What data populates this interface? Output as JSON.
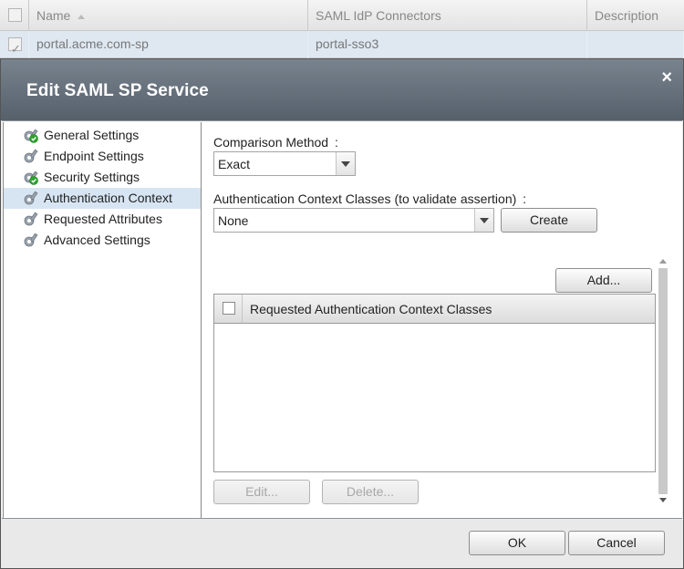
{
  "background_grid": {
    "columns": [
      "Name",
      "SAML IdP Connectors",
      "Description"
    ],
    "row": {
      "name": "portal.acme.com-sp",
      "connectors": "portal-sso3",
      "description": ""
    }
  },
  "dialog": {
    "title": "Edit SAML SP Service",
    "close_icon": "×",
    "nav": {
      "items": [
        {
          "label": "General Settings",
          "icon": "gear-check-icon",
          "selected": false
        },
        {
          "label": "Endpoint Settings",
          "icon": "gear-icon",
          "selected": false
        },
        {
          "label": "Security Settings",
          "icon": "gear-check-icon",
          "selected": false
        },
        {
          "label": "Authentication Context",
          "icon": "gear-icon",
          "selected": true
        },
        {
          "label": "Requested Attributes",
          "icon": "gear-icon",
          "selected": false
        },
        {
          "label": "Advanced Settings",
          "icon": "gear-icon",
          "selected": false
        }
      ]
    },
    "content": {
      "comparison_label": "Comparison Method",
      "comparison_colon": ":",
      "comparison_value": "Exact",
      "classes_label": "Authentication Context Classes (to validate assertion)",
      "classes_colon": ":",
      "classes_value": "None",
      "create_button": "Create",
      "add_button": "Add...",
      "table_header": "Requested Authentication Context Classes",
      "edit_button": "Edit...",
      "delete_button": "Delete..."
    },
    "footer": {
      "ok_button": "OK",
      "cancel_button": "Cancel"
    }
  },
  "colors": {
    "titlebar": "#5e6873",
    "selected_nav": "#d7e5f3",
    "background_row": "#dfe8f1",
    "check_green": "#2aa52a"
  }
}
